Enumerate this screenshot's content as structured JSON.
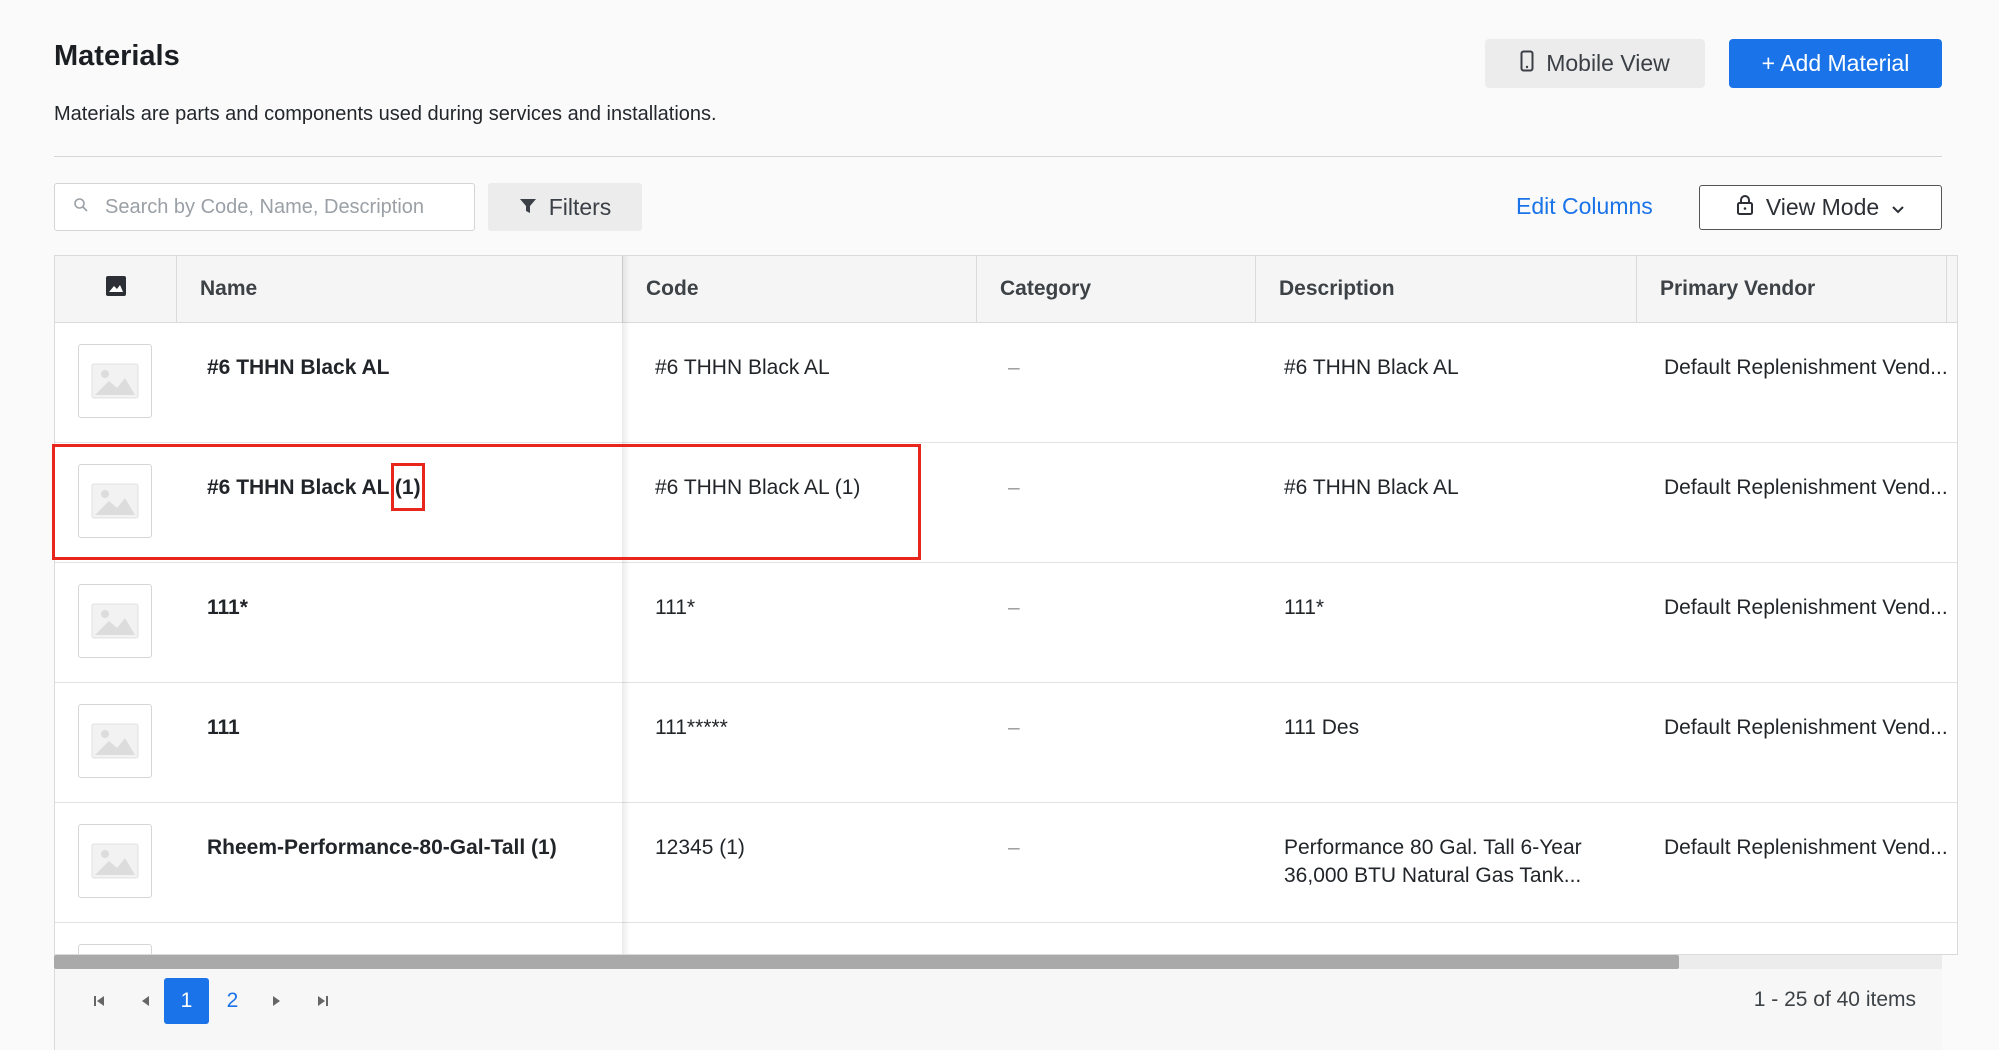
{
  "header": {
    "title": "Materials",
    "subtitle": "Materials are parts and components used during services and installations.",
    "mobile_view_label": "Mobile View",
    "add_material_label": "+ Add Material"
  },
  "toolbar": {
    "search_placeholder": "Search by Code, Name, Description",
    "filters_label": "Filters",
    "edit_columns_label": "Edit Columns",
    "view_mode_label": "View Mode"
  },
  "table": {
    "columns": [
      "Name",
      "Code",
      "Category",
      "Description",
      "Primary Vendor"
    ],
    "rows": [
      {
        "name": "#6 THHN Black AL",
        "code": "#6 THHN Black AL",
        "category": "–",
        "description": "#6 THHN Black AL",
        "description2": "",
        "vendor": "Default Replenishment Vend..."
      },
      {
        "name": "#6 THHN Black AL (1)",
        "code": "#6 THHN Black AL (1)",
        "category": "–",
        "description": "#6 THHN Black AL",
        "description2": "",
        "vendor": "Default Replenishment Vend..."
      },
      {
        "name": "111*",
        "code": "111*",
        "category": "–",
        "description": "111*",
        "description2": "",
        "vendor": "Default Replenishment Vend..."
      },
      {
        "name": "111",
        "code": "111*****",
        "category": "–",
        "description": "111 Des",
        "description2": "",
        "vendor": "Default Replenishment Vend..."
      },
      {
        "name": "Rheem-Performance-80-Gal-Tall (1)",
        "code": "12345 (1)",
        "category": "–",
        "description": "Performance 80 Gal. Tall 6-Year",
        "description2": "36,000 BTU Natural Gas Tank...",
        "vendor": "Default Replenishment Vend..."
      }
    ]
  },
  "pagination": {
    "pages": [
      "1",
      "2"
    ],
    "current_page": "1",
    "items_summary": "1 - 25 of 40 items"
  },
  "colors": {
    "accent": "#1a73e8",
    "highlight": "#e8261b"
  }
}
